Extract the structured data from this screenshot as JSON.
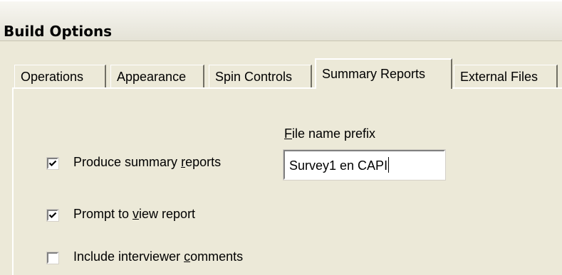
{
  "window": {
    "title": "Build Options"
  },
  "tabs": [
    {
      "label": "Operations",
      "active": false
    },
    {
      "label": "Appearance",
      "active": false
    },
    {
      "label": "Spin Controls",
      "active": false
    },
    {
      "label": "Summary Reports",
      "active": true
    },
    {
      "label": "External Files",
      "active": false
    }
  ],
  "panel": {
    "file_prefix_label": "File name prefix",
    "file_prefix_value": "Survey1 en CAPI",
    "checkboxes": [
      {
        "label": "Produce summary reports",
        "checked": true
      },
      {
        "label": "Prompt to view report",
        "checked": true
      },
      {
        "label": "Include interviewer comments",
        "checked": false
      }
    ]
  }
}
